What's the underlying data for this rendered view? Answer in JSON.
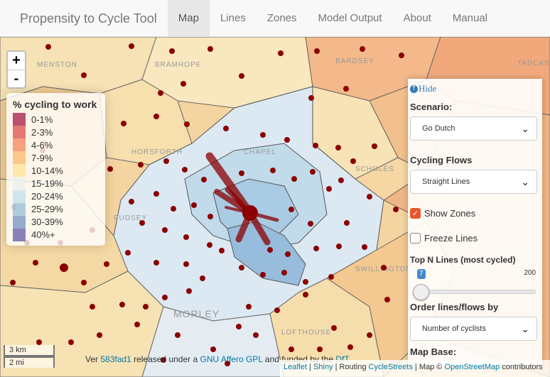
{
  "navbar": {
    "brand": "Propensity to Cycle Tool",
    "tabs": [
      {
        "label": "Map",
        "active": true
      },
      {
        "label": "Lines",
        "active": false
      },
      {
        "label": "Zones",
        "active": false
      },
      {
        "label": "Model Output",
        "active": false
      },
      {
        "label": "About",
        "active": false
      },
      {
        "label": "Manual",
        "active": false
      }
    ]
  },
  "zoom": {
    "in": "+",
    "out": "-"
  },
  "legend": {
    "title": "% cycling to work",
    "items": [
      {
        "label": "0-1%",
        "color": "#9c0b3e"
      },
      {
        "label": "2-3%",
        "color": "#d7463e"
      },
      {
        "label": "4-6%",
        "color": "#f57e4f"
      },
      {
        "label": "7-9%",
        "color": "#fbb462"
      },
      {
        "label": "10-14%",
        "color": "#fde28f"
      },
      {
        "label": "15-19%",
        "color": "#e8eef0"
      },
      {
        "label": "20-24%",
        "color": "#bcdbea"
      },
      {
        "label": "25-29%",
        "color": "#8fbbd8"
      },
      {
        "label": "30-39%",
        "color": "#6a8cc0"
      },
      {
        "label": "40%+",
        "color": "#5a4fa2"
      }
    ]
  },
  "map_labels": [
    "MENSTON",
    "BRAMHOPE",
    "BARDSEY",
    "TADCAS",
    "HORSFORTH",
    "CHAPEL",
    "SCHOLES",
    "PUDSEY",
    "SWILLINGTON",
    "MORLEY",
    "LOFTHOUSE"
  ],
  "scale": {
    "km": "3 km",
    "mi": "2 mi"
  },
  "footer": {
    "prefix": "Ver",
    "version": "583fad1",
    "mid": "released under a",
    "license": "GNU Affero GPL",
    "suffix": "and funded by the",
    "funder": "DfT"
  },
  "attribution": {
    "leaflet": "Leaflet",
    "sep1": "|",
    "shiny": "Shiny",
    "routing": "| Routing",
    "cyclestreets": "CycleStreets",
    "map": "| Map ©",
    "osm": "OpenStreetMap",
    "contrib": "contributors"
  },
  "panel": {
    "hide_label": "Hide",
    "scenario_label": "Scenario:",
    "scenario_value": "Go Dutch",
    "flows_label": "Cycling Flows",
    "flows_value": "Straight Lines",
    "show_zones_label": "Show Zones",
    "show_zones_checked": true,
    "freeze_lines_label": "Freeze Lines",
    "freeze_lines_checked": false,
    "topn_label": "Top N Lines (most cycled)",
    "topn_value": "7",
    "topn_max": "200",
    "order_label": "Order lines/flows by",
    "order_value": "Number of cyclists",
    "map_base_label": "Map Base:"
  }
}
